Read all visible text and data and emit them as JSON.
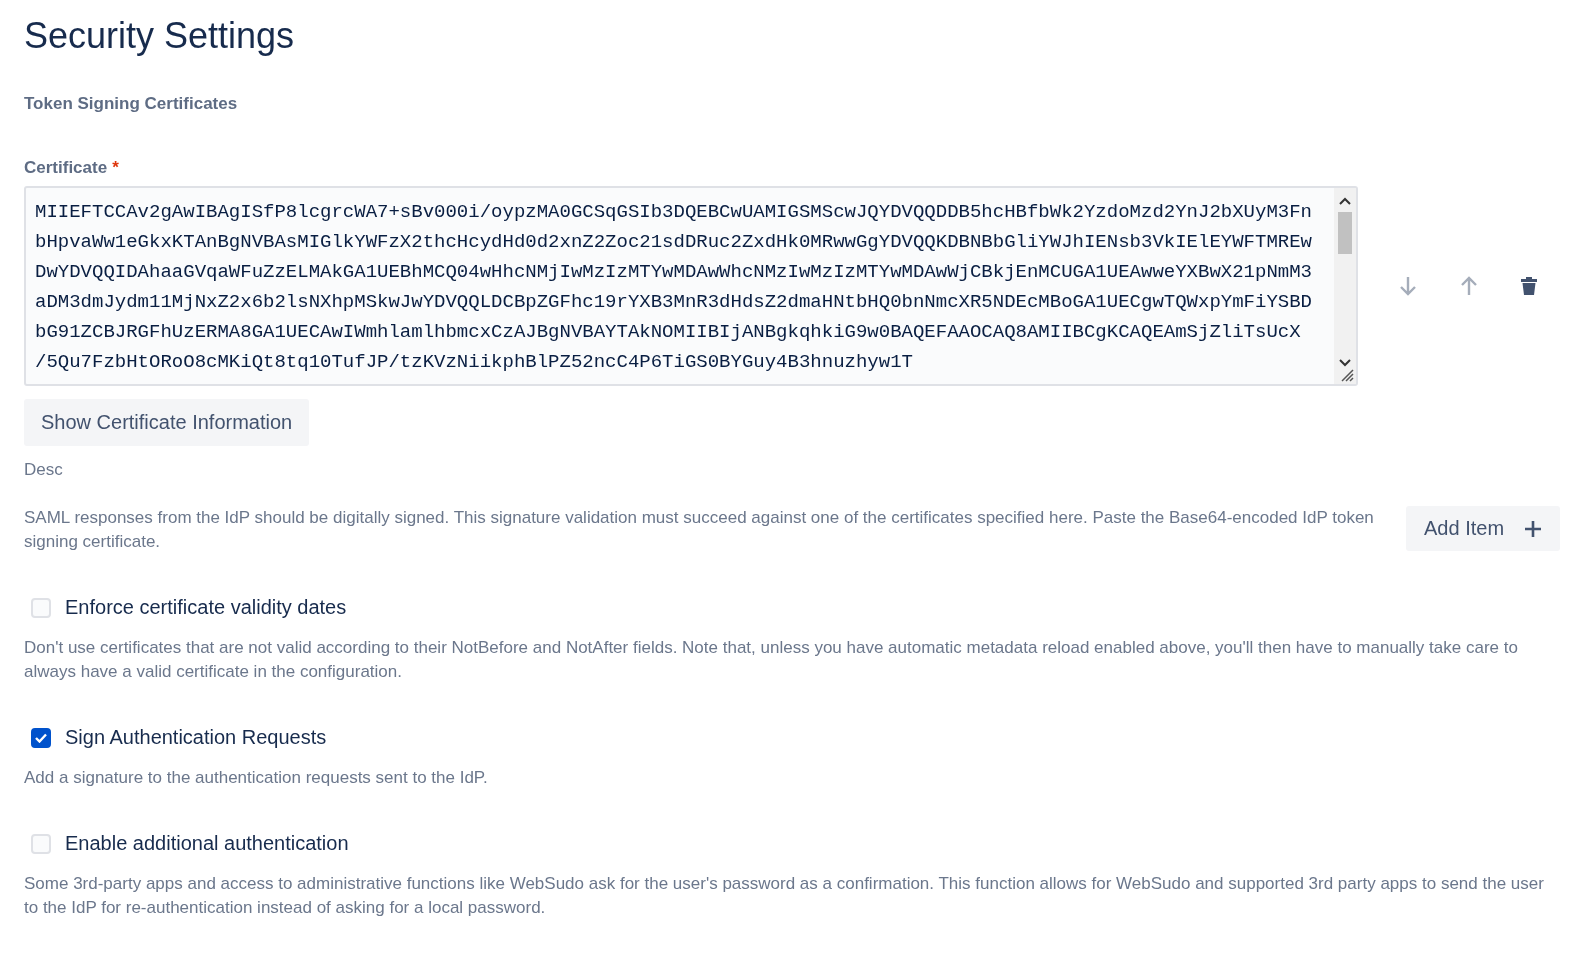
{
  "title": "Security Settings",
  "section": {
    "heading": "Token Signing Certificates",
    "certificate": {
      "label": "Certificate",
      "required_mark": "*",
      "lines": [
        "MIIEFTCCAv2gAwIBAgISfP8lcgrcWA7+sBv000i/oypzMA0GCSqGSIb3DQEBCwUAMIGSMScwJQYDVQQDDB5hcHBfbWk2YzdoMzd2YnJ2bXUyM3Fn",
        "bHpvaWw1eGkxKTAnBgNVBAsMIGlkYWFzX2thcHcydHd0d2xnZ2Zoc21sdDRuc2ZxdHk0MRwwGgYDVQQKDBNBbGliYWJhIENsb3VkIElEYWFTMREw",
        "DwYDVQQIDAhaaGVqaWFuZzELMAkGA1UEBhMCQ04wHhcNMjIwMzIzMTYwMDAwWhcNMzIwMzIzMTYwMDAwWjCBkjEnMCUGA1UEAwweYXBwX21pNmM3",
        "aDM3dmJydm11MjNxZ2x6b2lsNXhpMSkwJwYDVQQLDCBpZGFhc19rYXB3MnR3dHdsZ2dmaHNtbHQ0bnNmcXR5NDEcMBoGA1UECgwTQWxpYmFiYSBD",
        "bG91ZCBJRGFhUzERMA8GA1UECAwIWmhlamlhbmcxCzAJBgNVBAYTAkNOMIIBIjANBgkqhkiG9w0BAQEFAAOCAQ8AMIIBCgKCAQEAmSjZliTsUcX",
        "/5Qu7FzbHtORoO8cMKiQt8tq10TufJP/tzKVzNiikphBlPZ52ncC4P6TiGS0BYGuy4B3hnuzhyw1T"
      ],
      "move_down": {
        "disabled": true
      },
      "move_up": {
        "disabled": true
      },
      "show_button": "Show Certificate Information",
      "desc_label": "Desc"
    },
    "description": "SAML responses from the IdP should be digitally signed. This signature validation must succeed against one of the certificates specified here. Paste the Base64-encoded IdP token signing certificate.",
    "add_button": "Add Item"
  },
  "options": [
    {
      "label": "Enforce certificate validity dates",
      "checked": false,
      "help": "Don't use certificates that are not valid according to their NotBefore and NotAfter fields. Note that, unless you have automatic metadata reload enabled above, you'll then have to manually take care to always have a valid certificate in the configuration."
    },
    {
      "label": "Sign Authentication Requests",
      "checked": true,
      "help": "Add a signature to the authentication requests sent to the IdP."
    },
    {
      "label": "Enable additional authentication",
      "checked": false,
      "help": "Some 3rd-party apps and access to administrative functions like WebSudo ask for the user's password as a confirmation. This function allows for WebSudo and supported 3rd party apps to send the user to the IdP for re-authentication instead of asking for a local password."
    }
  ]
}
